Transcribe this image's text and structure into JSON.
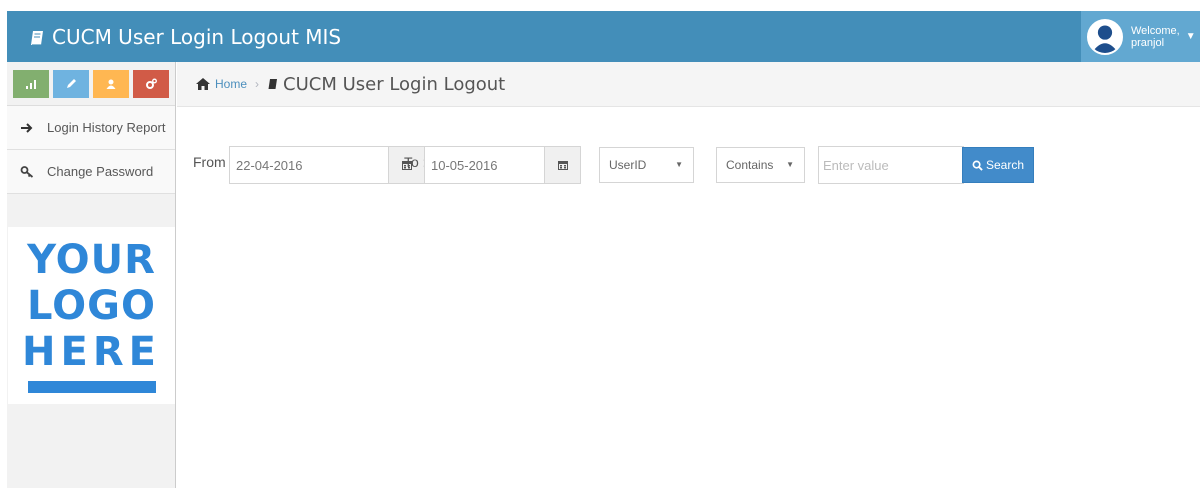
{
  "header": {
    "title": "CUCM User Login Logout MIS",
    "welcome": "Welcome,",
    "username": "pranjol",
    "brand_color": "#438eb9",
    "user_box_color": "#62a8d1"
  },
  "sidebar": {
    "shortcuts": [
      {
        "icon": "signal-icon",
        "color": "#82af6f"
      },
      {
        "icon": "pencil-icon",
        "color": "#6fb3e0"
      },
      {
        "icon": "users-icon",
        "color": "#ffb752"
      },
      {
        "icon": "cogs-icon",
        "color": "#d15b47"
      }
    ],
    "items": [
      {
        "label": "Login History Report",
        "icon": "arrow-right-icon"
      },
      {
        "label": "Change Password",
        "icon": "key-icon"
      }
    ],
    "logo": {
      "line1": "YOUR",
      "line2": "LOGO",
      "line3": "HERE",
      "color": "#2f87d8"
    }
  },
  "breadcrumb": {
    "home": "Home",
    "current": "CUCM User Login Logout"
  },
  "filters": {
    "from_label": "From :",
    "from_value": "22-04-2016",
    "to_label": "To :",
    "to_value": "10-05-2016",
    "field_select": "UserID",
    "operator_select": "Contains",
    "value_placeholder": "Enter value",
    "search_label": "Search"
  }
}
